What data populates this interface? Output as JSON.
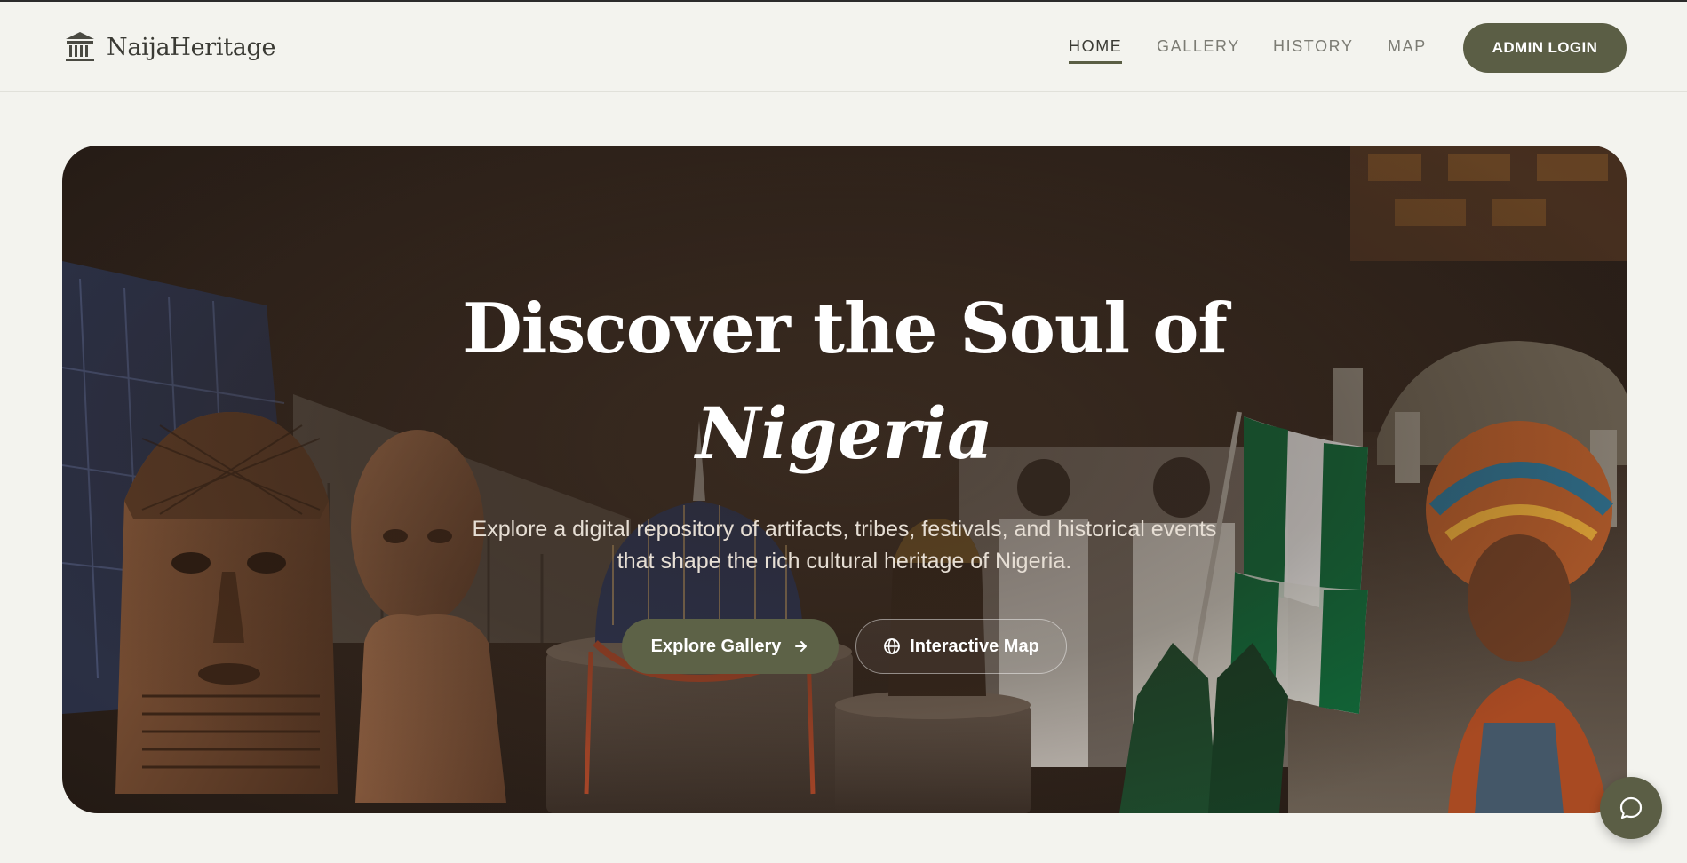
{
  "brand": {
    "name": "NaijaHeritage",
    "icon": "museum-icon"
  },
  "nav": {
    "items": [
      {
        "label": "HOME",
        "active": true
      },
      {
        "label": "GALLERY",
        "active": false
      },
      {
        "label": "HISTORY",
        "active": false
      },
      {
        "label": "MAP",
        "active": false
      }
    ],
    "admin_label": "ADMIN LOGIN"
  },
  "hero": {
    "title_line1": "Discover the Soul of",
    "title_line2": "Nigeria",
    "subtitle": "Explore a digital repository of artifacts, tribes, festivals, and historical events that shape the rich cultural heritage of Nigeria.",
    "primary_button": {
      "label": "Explore Gallery",
      "icon": "arrow-right-icon"
    },
    "secondary_button": {
      "label": "Interactive Map",
      "icon": "globe-icon"
    }
  },
  "chat": {
    "icon": "chat-bubble-icon"
  },
  "colors": {
    "page_bg": "#f3f3ee",
    "accent_olive": "#5b5e45",
    "nav_text": "#7c7c74",
    "hero_bg": "#3a2b21",
    "flag_green": "#0f6b3a"
  }
}
